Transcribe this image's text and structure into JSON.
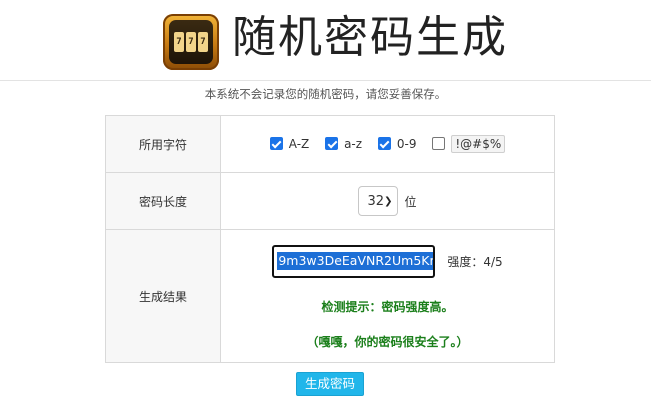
{
  "header": {
    "title": "随机密码生成",
    "subtitle": "本系统不会记录您的随机密码，请您妥善保存。"
  },
  "logo": {
    "slots": [
      "7",
      "7",
      "7"
    ]
  },
  "form": {
    "charset_label": "所用字符",
    "charsets": [
      {
        "label": "A-Z",
        "checked": true
      },
      {
        "label": "a-z",
        "checked": true
      },
      {
        "label": "0-9",
        "checked": true
      },
      {
        "label": "!@#$%",
        "checked": false
      }
    ],
    "length_label": "密码长度",
    "length_value": "32",
    "length_unit": "位",
    "result_label": "生成结果",
    "password": "9m3w3DeEaVNR2Um5Kr",
    "strength": "强度：4/5",
    "tip_check": "检测提示：密码强度高。",
    "tip_safe": "（嘎嘎，你的密码很安全了。）"
  },
  "actions": {
    "generate_label": "生成密码"
  },
  "colors": {
    "accent": "#21b6ea",
    "tip_green": "#1b7f1b",
    "checkbox_blue": "#1a73e8"
  }
}
